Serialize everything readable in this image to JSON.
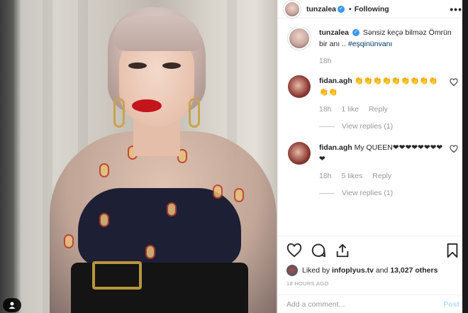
{
  "header": {
    "username": "tunzalea",
    "separator": "•",
    "follow_status": "Following",
    "more_label": "•••"
  },
  "caption": {
    "username": "tunzalea",
    "text": "Sənsiz keçə bilməz Ömrün bir anı .. ",
    "hashtag": "#eşqinünvanı",
    "time": "18h"
  },
  "comments": [
    {
      "username": "fidan.agh",
      "text": "👏👏👏👏👏👏👏👏👏👏👏",
      "time": "18h",
      "likes": "1 like",
      "reply_label": "Reply",
      "view_replies": "View replies (1)"
    },
    {
      "username": "fidan.agh",
      "text": "My QUEEN❤❤❤❤❤❤❤❤❤",
      "time": "18h",
      "likes": "5 likes",
      "reply_label": "Reply",
      "view_replies": "View replies (1)"
    }
  ],
  "liked_by": {
    "prefix": "Liked by ",
    "user": "infoplyus.tv",
    "middle": " and ",
    "count": "13,027 others"
  },
  "timestamp": "18 HOURS AGO",
  "add_comment": {
    "placeholder": "Add a comment...",
    "post_label": "Post"
  },
  "icons": {
    "like": "heart-outline-icon",
    "comment": "comment-bubble-icon",
    "share": "share-icon",
    "save": "bookmark-icon",
    "verified": "verified-badge-icon"
  },
  "colors": {
    "verified_blue": "#3897f0",
    "hashtag": "#003569",
    "muted": "#999999",
    "post_disabled": "#b2dffc"
  }
}
